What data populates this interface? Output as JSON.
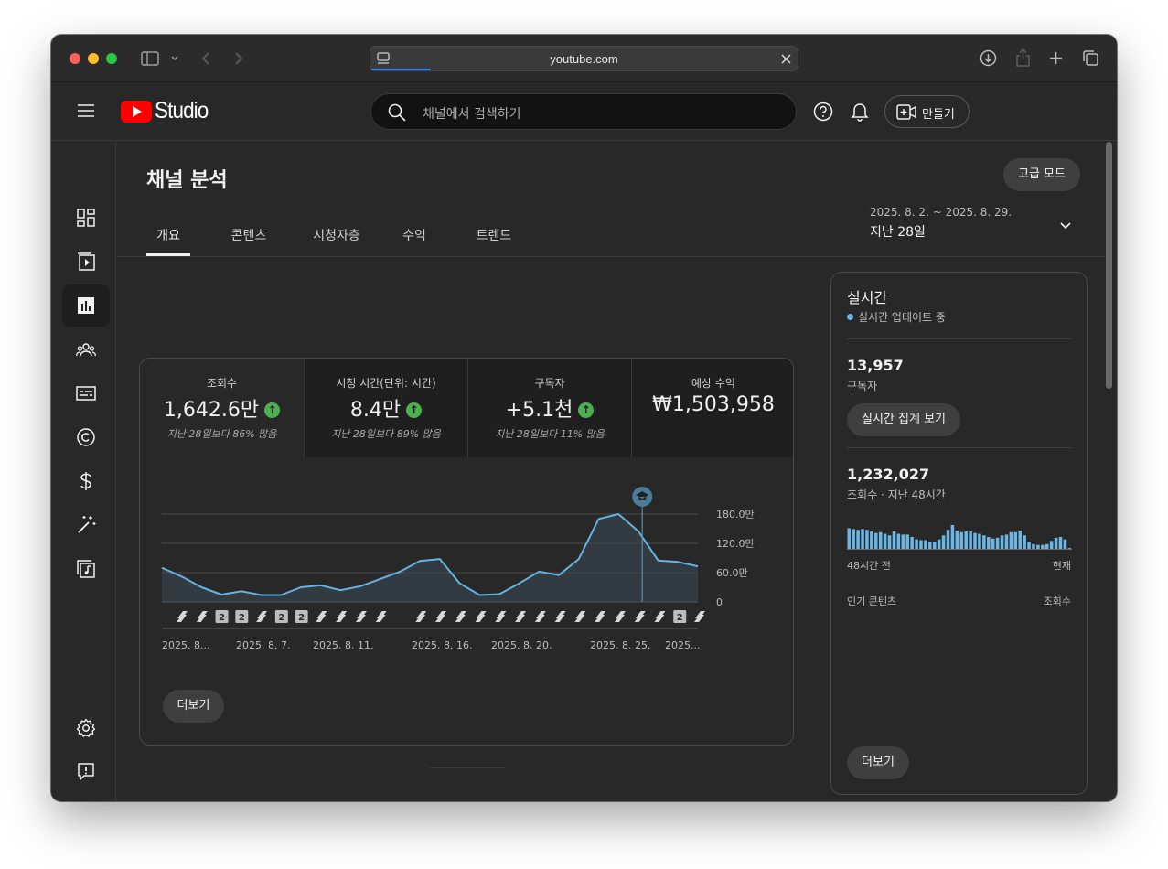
{
  "browser": {
    "url": "youtube.com"
  },
  "header": {
    "logo_text": "Studio",
    "search_placeholder": "채널에서 검색하기",
    "create_label": "만들기"
  },
  "page": {
    "title": "채널 분석",
    "advanced_mode": "고급 모드",
    "tabs": [
      "개요",
      "콘텐츠",
      "시청자층",
      "수익",
      "트렌드"
    ],
    "date_range": "2025. 8. 2. ~ 2025. 8. 29.",
    "date_period": "지난 28일"
  },
  "metrics": [
    {
      "label": "조회수",
      "value": "1,642.6만",
      "sub": "지난 28일보다 86% 많음",
      "trend": "up"
    },
    {
      "label": "시청 시간(단위: 시간)",
      "value": "8.4만",
      "sub": "지난 28일보다 89% 많음",
      "trend": "up"
    },
    {
      "label": "구독자",
      "value": "+5.1천",
      "sub": "지난 28일보다 11% 많음",
      "trend": "up"
    },
    {
      "label": "예상 수익",
      "value": "₩1,503,958",
      "sub": ""
    }
  ],
  "chart_data": {
    "type": "area",
    "y_ticks": [
      "180.0만",
      "120.0만",
      "60.0만",
      "0"
    ],
    "ylim": [
      0,
      180
    ],
    "values": [
      70,
      52,
      30,
      15,
      22,
      14,
      14,
      30,
      34,
      24,
      32,
      47,
      62,
      84,
      88,
      38,
      14,
      16,
      38,
      62,
      55,
      88,
      170,
      180,
      145,
      85,
      82,
      73
    ],
    "x_labels": [
      "2025. 8...",
      "2025. 8. 7.",
      "2025. 8. 11.",
      "2025. 8. 16.",
      "2025. 8. 20.",
      "2025. 8. 25.",
      "2025..."
    ],
    "upload_markers": [
      "s",
      "s",
      "2",
      "2",
      "s",
      "2",
      "2",
      "s",
      "s",
      "s",
      "s",
      "",
      "s",
      "s",
      "s",
      "s",
      "s",
      "s",
      "s",
      "s",
      "s",
      "s",
      "s",
      "s",
      "s",
      "2",
      "s"
    ]
  },
  "card_more": "더보기",
  "realtime": {
    "title": "실시간",
    "status": "실시간 업데이트 중",
    "subscribers": "13,957",
    "subscribers_label": "구독자",
    "rt_button": "실시간 집계 보기",
    "views": "1,232,027",
    "views_label": "조회수 · 지난 48시간",
    "bar_values": [
      26,
      25,
      24,
      25,
      24,
      22,
      20,
      21,
      19,
      17,
      22,
      19,
      18,
      18,
      15,
      12,
      11,
      11,
      9,
      9,
      12,
      17,
      24,
      30,
      23,
      21,
      22,
      22,
      20,
      19,
      17,
      15,
      13,
      14,
      17,
      18,
      21,
      21,
      23,
      17,
      9,
      6,
      5,
      5,
      6,
      10,
      14,
      15,
      12,
      1
    ],
    "axis_left": "48시간 전",
    "axis_right": "현재",
    "top_content": "인기 콘텐츠",
    "top_content_metric": "조회수",
    "more": "더보기"
  }
}
